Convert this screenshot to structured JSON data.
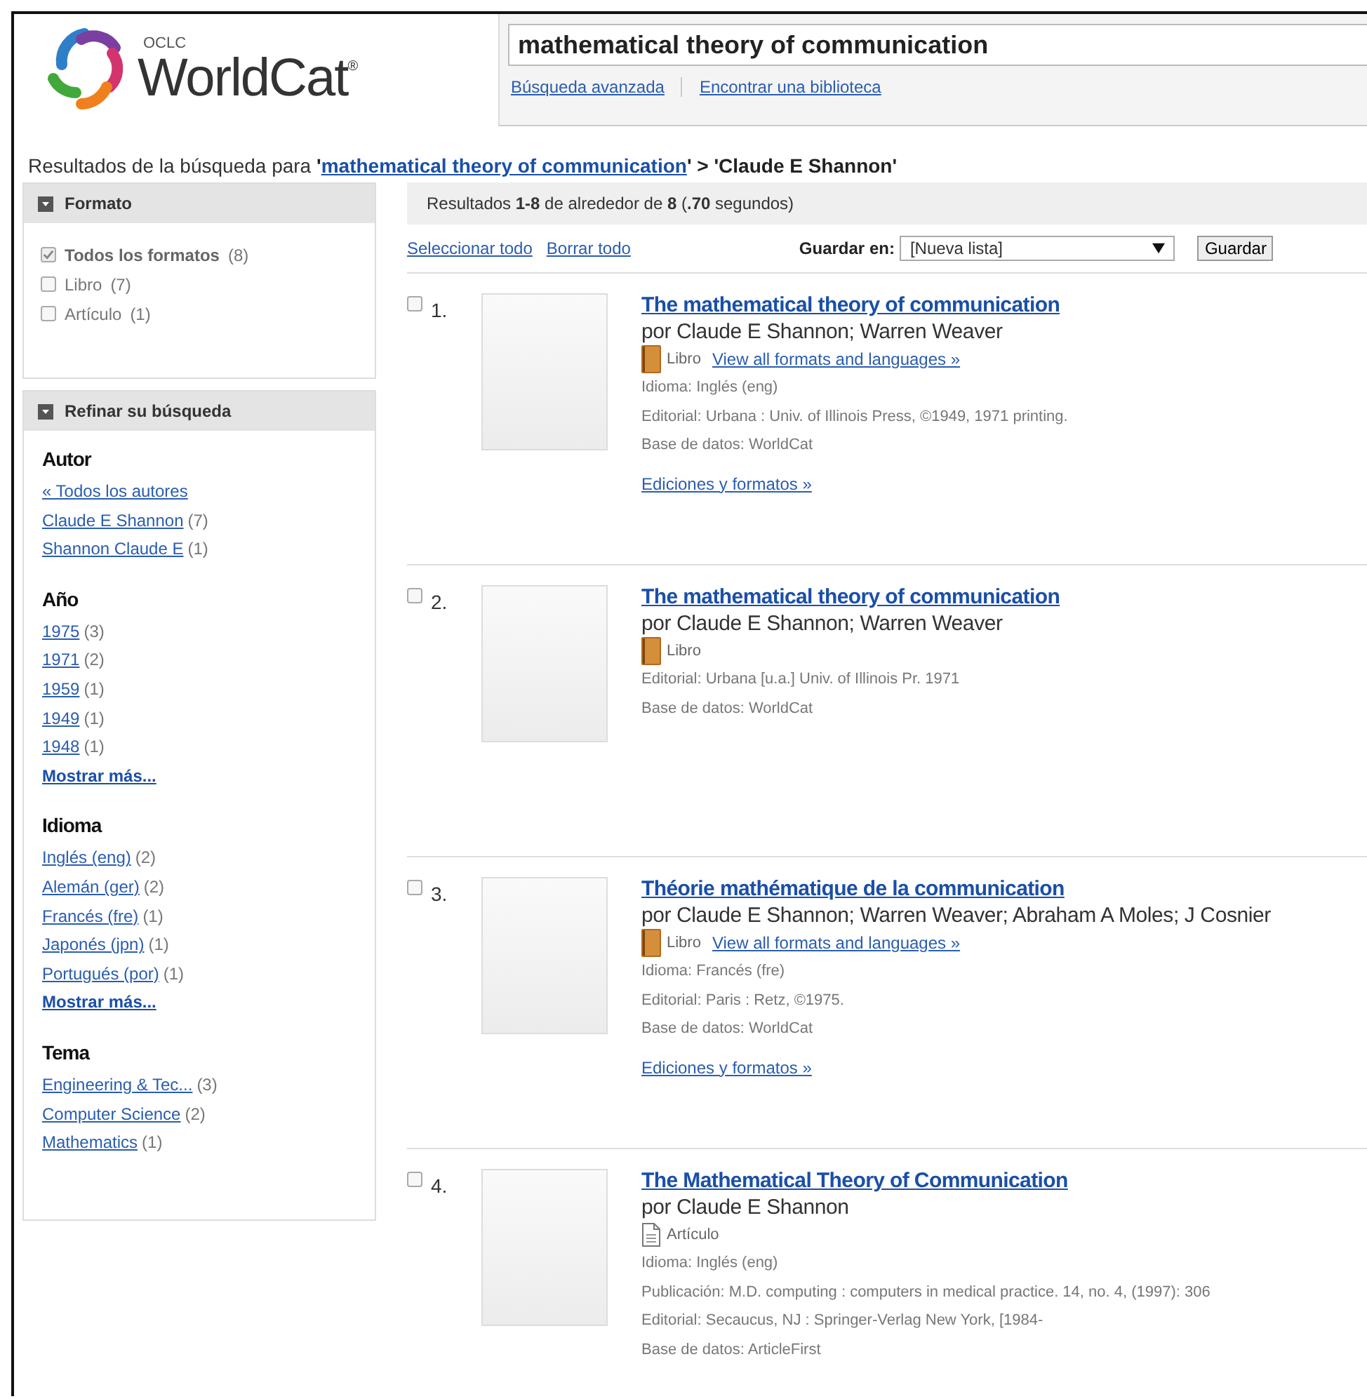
{
  "header": {
    "logo": {
      "org": "OCLC",
      "name": "WorldCat",
      "mark": "®"
    },
    "search": {
      "value": "mathematical theory of communication"
    },
    "links": [
      "Búsqueda avanzada",
      "Encontrar una biblioteca"
    ]
  },
  "breadcrumb": [
    {
      "kind": "plain",
      "text": "Resultados de la búsqueda para "
    },
    {
      "kind": "bold",
      "text": "'"
    },
    {
      "kind": "link",
      "text": "mathematical theory of communication"
    },
    {
      "kind": "bold",
      "text": "' > 'Claude E Shannon'"
    }
  ],
  "format_panel": {
    "title": "Formato",
    "options": [
      {
        "label": "Todos los formatos",
        "count": "(8)",
        "checked": true
      },
      {
        "label": "Libro",
        "count": "(7)",
        "checked": false
      },
      {
        "label": "Artículo",
        "count": "(1)",
        "checked": false
      }
    ]
  },
  "refine_panel": {
    "title": "Refinar su búsqueda",
    "groups": [
      {
        "heading": "Autor",
        "items": [
          {
            "kind": "link",
            "label": "« Todos los autores"
          },
          {
            "kind": "link",
            "label": "Claude E Shannon",
            "count": "(7)"
          },
          {
            "kind": "link",
            "label": "Shannon Claude E",
            "count": "(1)"
          }
        ]
      },
      {
        "heading": "Año",
        "items": [
          {
            "kind": "link",
            "label": "1975",
            "count": "(3)"
          },
          {
            "kind": "link",
            "label": "1971",
            "count": "(2)"
          },
          {
            "kind": "link",
            "label": "1959",
            "count": "(1)"
          },
          {
            "kind": "link",
            "label": "1949",
            "count": "(1)"
          },
          {
            "kind": "link",
            "label": "1948",
            "count": "(1)"
          },
          {
            "kind": "more",
            "label": "Mostrar más..."
          }
        ]
      },
      {
        "heading": "Idioma",
        "items": [
          {
            "kind": "link",
            "label": "Inglés (eng)",
            "count": "(2)"
          },
          {
            "kind": "link",
            "label": "Alemán (ger)",
            "count": "(2)"
          },
          {
            "kind": "link",
            "label": "Francés (fre)",
            "count": "(1)"
          },
          {
            "kind": "link",
            "label": "Japonés (jpn)",
            "count": "(1)"
          },
          {
            "kind": "link",
            "label": "Portugués (por)",
            "count": "(1)"
          },
          {
            "kind": "more",
            "label": "Mostrar más..."
          }
        ]
      },
      {
        "heading": "Tema",
        "items": [
          {
            "kind": "link",
            "label": "Engineering & Tec...",
            "count": "(3)"
          },
          {
            "kind": "link",
            "label": "Computer Science",
            "count": "(2)"
          },
          {
            "kind": "link",
            "label": "Mathematics",
            "count": "(1)"
          }
        ]
      }
    ]
  },
  "results_summary": "Resultados **1-8** de alrededor de **8** (**.70** segundos)",
  "actions": {
    "select_all": "Seleccionar todo",
    "clear_all": "Borrar todo",
    "save_label": "Guardar en:",
    "list_select": "[Nueva lista]",
    "save_button": "Guardar"
  },
  "results": [
    {
      "number": "1.",
      "checked": false,
      "title": "The mathematical theory of communication",
      "authors": "por Claude E Shannon; Warren Weaver",
      "format": {
        "kind": "book",
        "label": "Libro"
      },
      "formats_link": "View all formats and languages »",
      "details": [
        "Idioma: Inglés (eng)",
        "Editorial: Urbana : Univ. of Illinois Press, ©1949, 1971 printing.",
        "Base de datos: WorldCat"
      ],
      "editions_link": "Ediciones y formatos »"
    },
    {
      "number": "2.",
      "checked": false,
      "title": "The mathematical theory of communication",
      "authors": "por Claude E Shannon; Warren Weaver",
      "format": {
        "kind": "book",
        "label": "Libro"
      },
      "details": [
        "Editorial: Urbana [u.a.] Univ. of Illinois Pr. 1971",
        "Base de datos: WorldCat"
      ]
    },
    {
      "number": "3.",
      "checked": false,
      "title": "Théorie mathématique de la communication",
      "authors": "por Claude E Shannon; Warren Weaver; Abraham A Moles; J Cosnier",
      "format": {
        "kind": "book",
        "label": "Libro"
      },
      "formats_link": "View all formats and languages »",
      "details": [
        "Idioma: Francés (fre)",
        "Editorial: Paris : Retz, ©1975.",
        "Base de datos: WorldCat"
      ],
      "editions_link": "Ediciones y formatos »"
    },
    {
      "number": "4.",
      "checked": false,
      "title": "The Mathematical Theory of Communication",
      "authors": "por Claude E Shannon",
      "format": {
        "kind": "article",
        "label": "Artículo"
      },
      "details": [
        "Idioma: Inglés (eng)",
        "Publicación: M.D. computing : computers in medical practice. 14, no. 4, (1997): 306",
        "Editorial: Secaucus, NJ : Springer-Verlag New York, [1984-",
        "Base de datos: ArticleFirst"
      ]
    }
  ]
}
